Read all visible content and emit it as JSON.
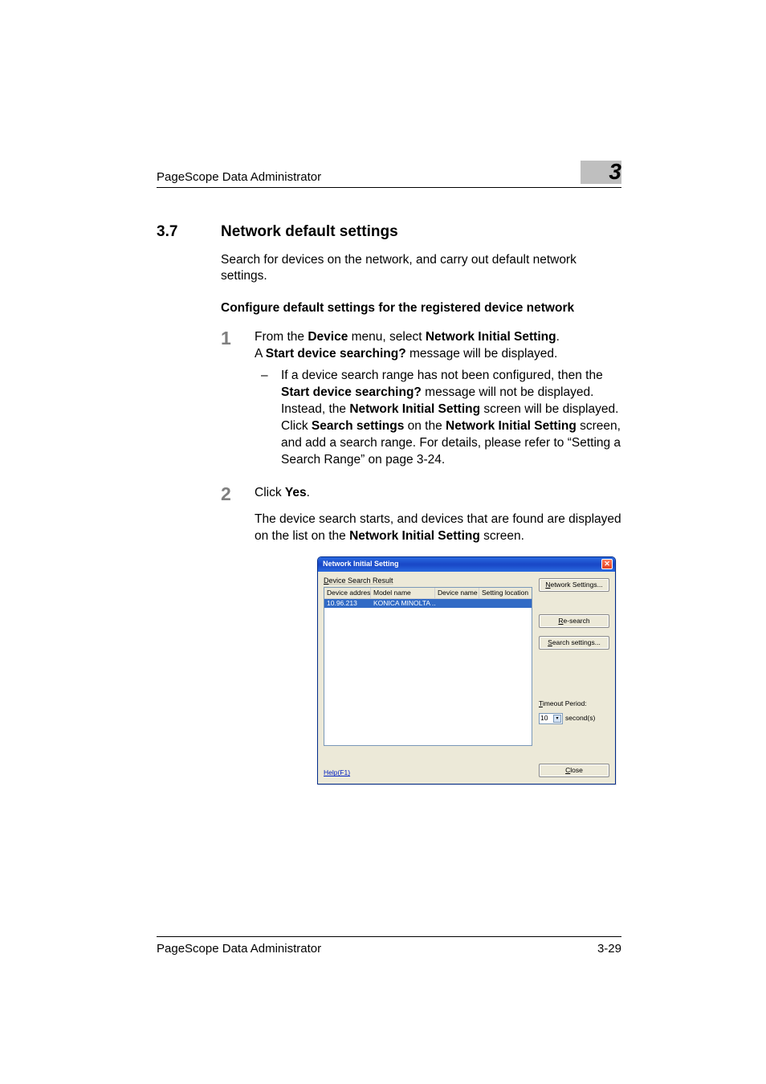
{
  "header": {
    "doc_title": "PageScope Data Administrator",
    "chapter_number": "3"
  },
  "section": {
    "number": "3.7",
    "title": "Network default settings",
    "intro": "Search for devices on the network, and carry out default network settings.",
    "subhead": "Configure default settings for the registered device network"
  },
  "steps": {
    "s1": {
      "num": "1",
      "t1": "From the ",
      "t2": "Device",
      "t3": " menu, select ",
      "t4": "Network Initial Setting",
      "t5": ".",
      "l2a": "A ",
      "l2b": "Start device searching?",
      "l2c": " message will be displayed.",
      "bullet_dash": "–",
      "b1": "If a device search range has not been configured, then the ",
      "b2": "Start device searching?",
      "b3": " message will not be displayed. Instead, the ",
      "b4": "Network Initial Setting",
      "b5": " screen will be displayed. Click ",
      "b6": "Search settings",
      "b7": " on the ",
      "b8": "Network Initial Setting",
      "b9": " screen, and add a search range. For details, please refer to “Setting a Search Range” on page 3-24."
    },
    "s2": {
      "num": "2",
      "t1": "Click ",
      "t2": "Yes",
      "t3": ".",
      "r1": "The device search starts, and devices that are found are displayed on the list on the ",
      "r2": "Network Initial Setting",
      "r3": " screen."
    }
  },
  "dialog": {
    "title": "Network Initial Setting",
    "search_label_pre": "D",
    "search_label_rest": "evice Search Result",
    "columns": {
      "c1": "Device address",
      "c2": "Model name",
      "c3": "Device name",
      "c4": "Setting location"
    },
    "row": {
      "address": "10.96.213",
      "model": "KONICA MINOLTA ...",
      "name": "",
      "location": ""
    },
    "buttons": {
      "network": "Network Settings...",
      "research": "Re-search",
      "searchset": "Search settings...",
      "close": "Close"
    },
    "timeout": {
      "label_pre": "T",
      "label_rest": "imeout Period:",
      "value": "10",
      "unit": "second(s)"
    },
    "help": "Help(F1)",
    "close_x": "✕"
  },
  "footer": {
    "doc_title": "PageScope Data Administrator",
    "page": "3-29"
  }
}
